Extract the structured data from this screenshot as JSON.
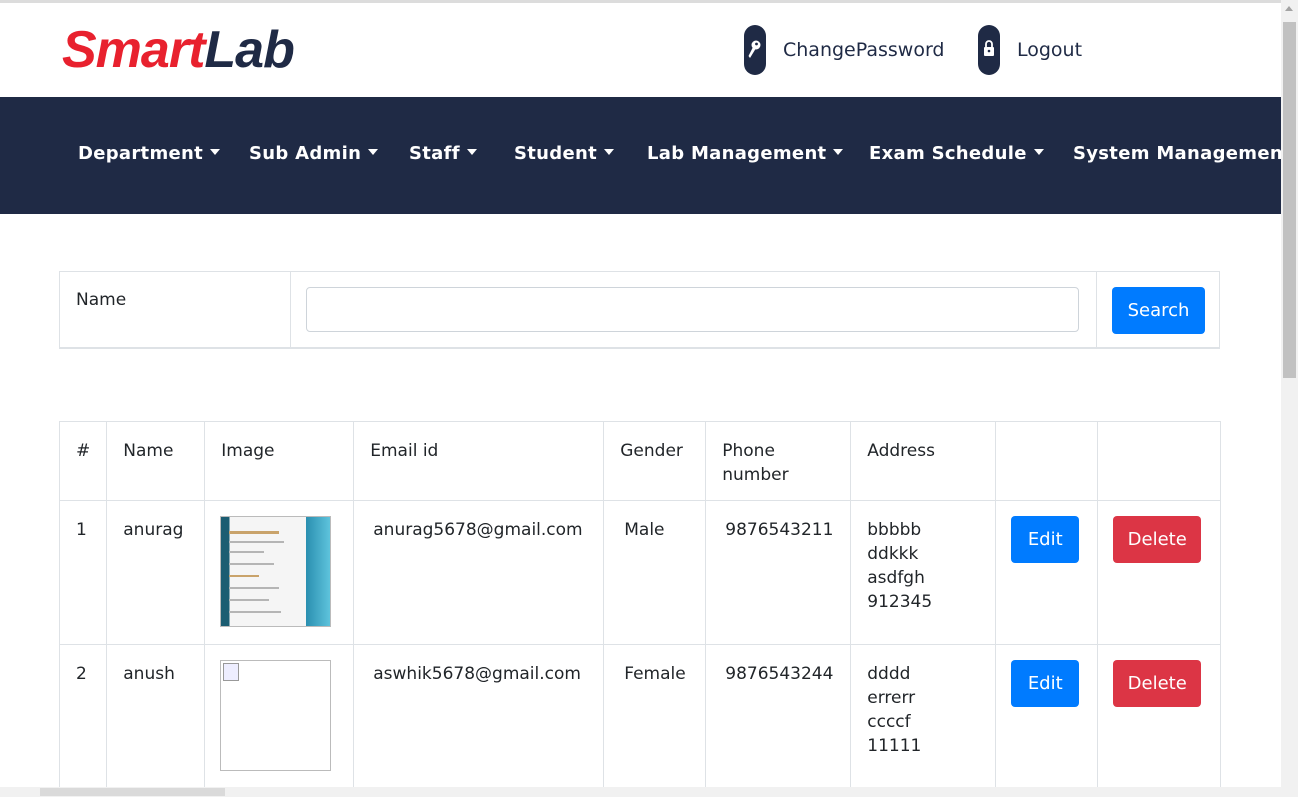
{
  "brand": {
    "part1": "Smart",
    "part2": "Lab"
  },
  "header_links": {
    "change_password": "ChangePassword",
    "logout": "Logout"
  },
  "nav": [
    {
      "label": "Department"
    },
    {
      "label": "Sub Admin"
    },
    {
      "label": "Staff"
    },
    {
      "label": "Student"
    },
    {
      "label": "Lab Management"
    },
    {
      "label": "Exam Schedule"
    },
    {
      "label": "System Management"
    }
  ],
  "search": {
    "label": "Name",
    "value": "",
    "placeholder": "",
    "button": "Search"
  },
  "table": {
    "headers": [
      "#",
      "Name",
      "Image",
      "Email id",
      "Gender",
      "Phone number",
      "Address",
      "",
      ""
    ],
    "rows": [
      {
        "num": "1",
        "name": "anurag",
        "email": "anurag5678@gmail.com",
        "gender": "Male",
        "phone": "9876543211",
        "address": [
          "bbbbb",
          "ddkkk",
          "asdfgh",
          "912345"
        ],
        "edit": "Edit",
        "delete": "Delete"
      },
      {
        "num": "2",
        "name": "anush",
        "email": "aswhik5678@gmail.com",
        "gender": "Female",
        "phone": "9876543244",
        "address": [
          "dddd",
          "errerr",
          "ccccf",
          "11111"
        ],
        "edit": "Edit",
        "delete": "Delete"
      }
    ]
  },
  "colors": {
    "navy": "#1f2a45",
    "red_brand": "#e8212e",
    "primary": "#007bff",
    "danger": "#dc3545"
  },
  "icons": {
    "change_password": "key-icon",
    "logout": "lock-icon",
    "nav_dropdown": "caret-down-icon"
  }
}
